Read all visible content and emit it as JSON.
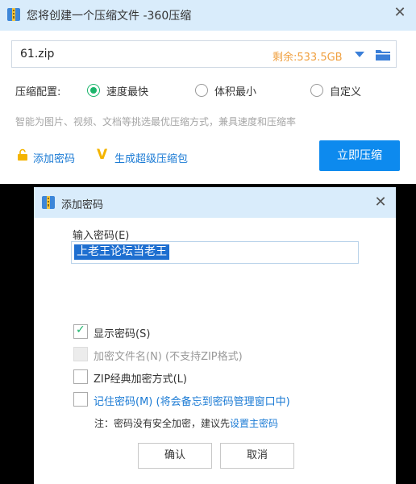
{
  "main_window": {
    "title": "您将创建一个压缩文件 -360压缩",
    "close_glyph": "✕",
    "path": {
      "value": "61.zip",
      "free_space": "剩余:533.5GB"
    },
    "config": {
      "label": "压缩配置:",
      "options": [
        {
          "label": "速度最快",
          "selected": true
        },
        {
          "label": "体积最小",
          "selected": false
        },
        {
          "label": "自定义",
          "selected": false
        }
      ]
    },
    "hint": "智能为图片、视频、文档等挑选最优压缩方式，兼具速度和压缩率",
    "add_password_link": "添加密码",
    "super_zip_link": "生成超级压缩包",
    "super_zip_icon_glyph": "V",
    "compress_button": "立即压缩",
    "colors": {
      "titlebar": "#d9ecfb",
      "primary_button": "#0d8aee",
      "link": "#1a7ad4",
      "free_space": "#f0a040",
      "radio_selected": "#1bb56b"
    }
  },
  "password_dialog": {
    "title": "添加密码",
    "close_glyph": "✕",
    "input_label": "输入密码(E)",
    "password_value": "上老王论坛当老王",
    "checkboxes": [
      {
        "label": "显示密码(S)",
        "checked": true,
        "enabled": true
      },
      {
        "label": "加密文件名(N) (不支持ZIP格式)",
        "checked": false,
        "enabled": false
      },
      {
        "label": "ZIP经典加密方式(L)",
        "checked": false,
        "enabled": true
      },
      {
        "label": "记住密码(M) (将会备忘到密码管理窗口中)",
        "checked": false,
        "enabled": true
      }
    ],
    "note": "注：密码没有安全加密，建议先",
    "note_link": "设置主密码",
    "ok_button": "确认",
    "cancel_button": "取消"
  }
}
